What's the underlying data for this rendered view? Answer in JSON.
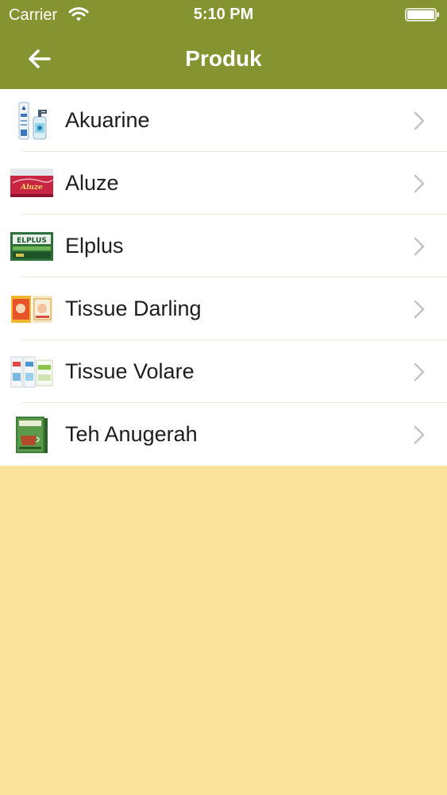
{
  "status_bar": {
    "carrier": "Carrier",
    "time": "5:10 PM",
    "wifi_icon": "wifi-icon",
    "battery_icon": "battery-icon"
  },
  "nav": {
    "title": "Produk",
    "back_icon": "arrow-left-icon"
  },
  "colors": {
    "header": "#859331",
    "background": "#fbe39e",
    "list_background": "#ffffff",
    "separator": "#e7ebd3",
    "chevron": "#c3c3c3"
  },
  "products": [
    {
      "label": "Akuarine",
      "icon": "akuarine-product-thumbnail"
    },
    {
      "label": "Aluze",
      "icon": "aluze-product-thumbnail"
    },
    {
      "label": "Elplus",
      "icon": "elplus-product-thumbnail"
    },
    {
      "label": "Tissue Darling",
      "icon": "tissue-darling-product-thumbnail"
    },
    {
      "label": "Tissue Volare",
      "icon": "tissue-volare-product-thumbnail"
    },
    {
      "label": "Teh Anugerah",
      "icon": "teh-anugerah-product-thumbnail"
    }
  ]
}
